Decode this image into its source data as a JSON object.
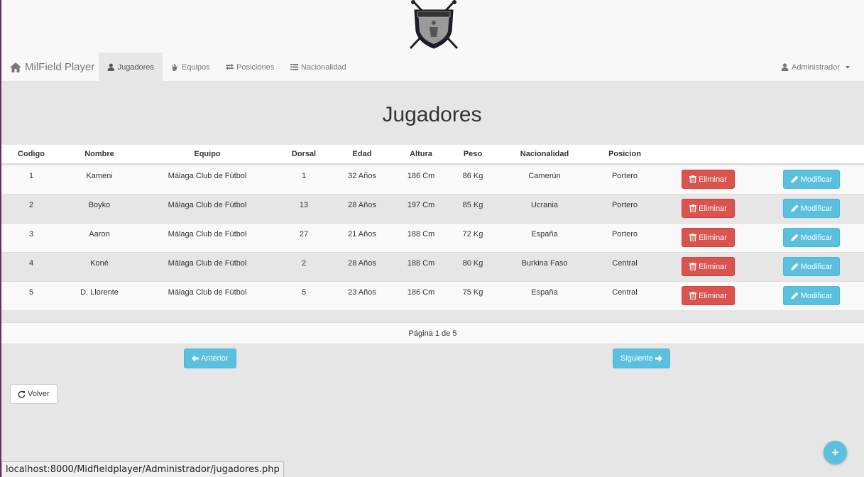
{
  "navbar": {
    "brand": "MilField Player",
    "items": [
      {
        "label": "Jugadores"
      },
      {
        "label": "Equipos"
      },
      {
        "label": "Posiciones"
      },
      {
        "label": "Nacionalidad"
      }
    ],
    "user": "Administrador"
  },
  "page": {
    "title": "Jugadores"
  },
  "table": {
    "headers": [
      "Codigo",
      "Nombre",
      "Equipo",
      "Dorsal",
      "Edad",
      "Altura",
      "Peso",
      "Nacionalidad",
      "Posicion"
    ],
    "rows": [
      [
        "1",
        "Kameni",
        "Málaga Club de Fútbol",
        "1",
        "32 Años",
        "186 Cm",
        "86 Kg",
        "Camerún",
        "Portero"
      ],
      [
        "2",
        "Boyko",
        "Málaga Club de Fútbol",
        "13",
        "28 Años",
        "197 Cm",
        "85 Kg",
        "Ucrania",
        "Portero"
      ],
      [
        "3",
        "Aaron",
        "Málaga Club de Fútbol",
        "27",
        "21 Años",
        "188 Cm",
        "72 Kg",
        "España",
        "Portero"
      ],
      [
        "4",
        "Koné",
        "Málaga Club de Fútbol",
        "2",
        "28 Años",
        "188 Cm",
        "80 Kg",
        "Burkina Faso",
        "Central"
      ],
      [
        "5",
        "D. Llorente",
        "Málaga Club de Fútbol",
        "5",
        "23 Años",
        "186 Cm",
        "75 Kg",
        "España",
        "Central"
      ]
    ],
    "delete_label": "Eliminar",
    "edit_label": "Modificar"
  },
  "pagination": {
    "info": "Página 1 de 5",
    "prev_label": "Anterior",
    "next_label": "Siguiente"
  },
  "back_label": "Volver",
  "fab_label": "+",
  "status_url": "localhost:8000/Midfieldplayer/Administrador/jugadores.php",
  "colors": {
    "danger": "#d9534f",
    "info": "#5bc0de",
    "navbar": "#f8f8f8",
    "background": "#e6e6e6"
  }
}
